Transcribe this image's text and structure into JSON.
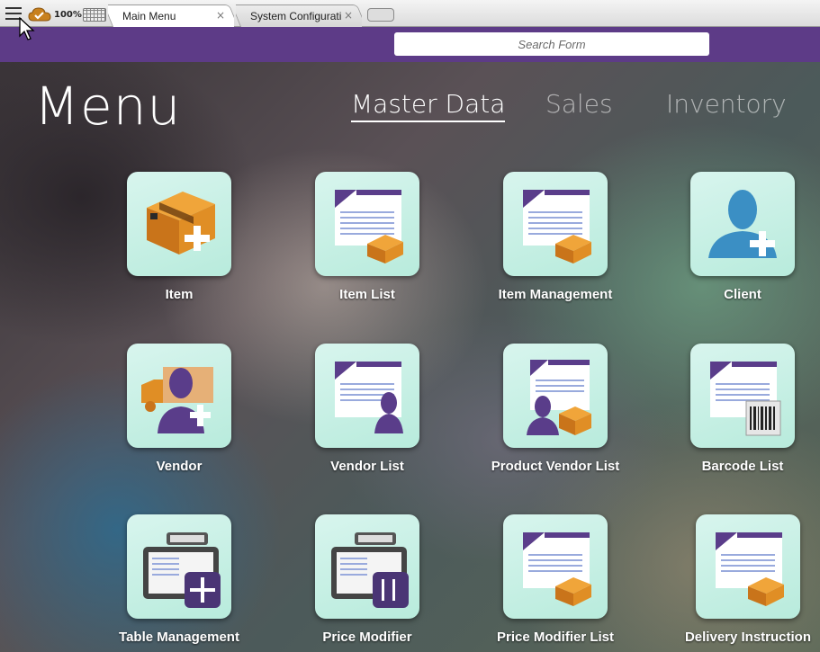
{
  "toolbar": {
    "zoom": "100%",
    "tabs": [
      {
        "label": "Main Menu",
        "close": "×"
      },
      {
        "label": "System Configurati",
        "close": "×"
      }
    ]
  },
  "search": {
    "placeholder": "Search Form"
  },
  "page": {
    "title": "Menu"
  },
  "menu_tabs": [
    {
      "label": "Master Data",
      "active": true
    },
    {
      "label": "Sales",
      "active": false
    },
    {
      "label": "Inventory",
      "active": false
    }
  ],
  "tiles": [
    {
      "label": "Item",
      "icon": "box-add-icon"
    },
    {
      "label": "Item List",
      "icon": "item-list-icon"
    },
    {
      "label": "Item Management",
      "icon": "item-management-icon"
    },
    {
      "label": "Client",
      "icon": "client-add-icon"
    },
    {
      "label": "Vendor",
      "icon": "vendor-add-icon"
    },
    {
      "label": "Vendor List",
      "icon": "vendor-list-icon"
    },
    {
      "label": "Product Vendor List",
      "icon": "product-vendor-list-icon"
    },
    {
      "label": "Barcode List",
      "icon": "barcode-list-icon"
    },
    {
      "label": "Table Management",
      "icon": "table-management-icon"
    },
    {
      "label": "Price Modifier",
      "icon": "price-modifier-icon"
    },
    {
      "label": "Price Modifier List",
      "icon": "price-modifier-list-icon"
    },
    {
      "label": "Delivery Instruction",
      "icon": "delivery-instruction-icon"
    }
  ],
  "colors": {
    "header_purple": "#5d3b87",
    "tile_mint": "#c6efe3",
    "box_orange": "#d9861a"
  }
}
